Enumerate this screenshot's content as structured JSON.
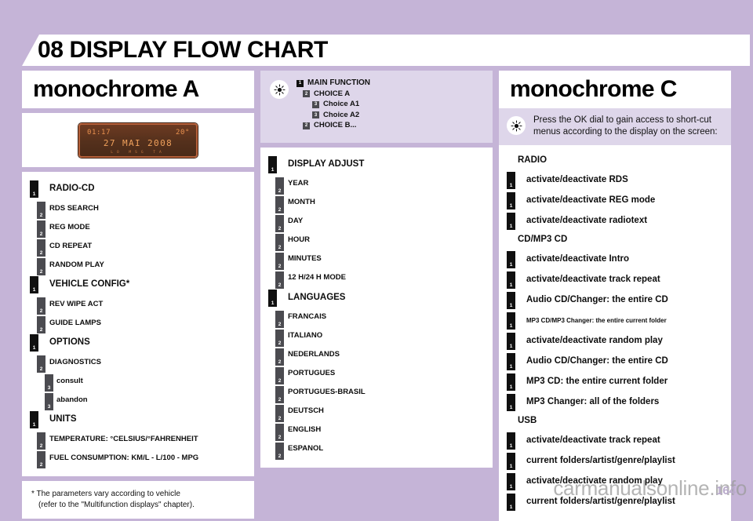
{
  "page": {
    "chapter_number": "08",
    "title": "08 DISPLAY FLOW CHART",
    "page_number": "164",
    "watermark": "carmanualsonline.info",
    "background_color": "#c5b4d7",
    "badge_level1_color": "#101010",
    "badge_level2_color": "#4b4b50"
  },
  "column_a": {
    "title": "monochrome A",
    "display": {
      "time": "01:17",
      "temperature": "20°",
      "date": "27 MAI 2008",
      "subline": "LO   MSG  TA"
    },
    "items": [
      {
        "level": "1",
        "badge": "1",
        "label": "RADIO-CD"
      },
      {
        "level": "2",
        "badge": "2",
        "label": "RDS SEARCH"
      },
      {
        "level": "2",
        "badge": "2",
        "label": "REG MODE"
      },
      {
        "level": "2",
        "badge": "2",
        "label": "CD REPEAT"
      },
      {
        "level": "2",
        "badge": "2",
        "label": "RANDOM PLAY"
      },
      {
        "level": "1",
        "badge": "1",
        "label": "VEHICLE CONFIG*"
      },
      {
        "level": "2",
        "badge": "2",
        "label": "REV WIPE ACT"
      },
      {
        "level": "2",
        "badge": "2",
        "label": "GUIDE LAMPS"
      },
      {
        "level": "1",
        "badge": "1",
        "label": "OPTIONS"
      },
      {
        "level": "2",
        "badge": "2",
        "label": "DIAGNOSTICS"
      },
      {
        "level": "3",
        "badge": "3",
        "label": "consult"
      },
      {
        "level": "3",
        "badge": "3",
        "label": "abandon"
      },
      {
        "level": "1",
        "badge": "1",
        "label": "UNITS"
      },
      {
        "level": "2",
        "badge": "2",
        "label": "TEMPERATURE: °CELSIUS/°FAHRENHEIT"
      },
      {
        "level": "2",
        "badge": "2",
        "label": "FUEL CONSUMPTION: KM/L - L/100 - MPG"
      }
    ],
    "footnote_line1": "* The parameters vary according to vehicle",
    "footnote_line2": "(refer to the \"Multifunction displays\" chapter)."
  },
  "column_b": {
    "legend_icon": "lightbulb-icon",
    "legend": [
      {
        "level": "1",
        "badge": "1",
        "label": "MAIN FUNCTION"
      },
      {
        "level": "2",
        "badge": "2",
        "label": "CHOICE A"
      },
      {
        "level": "3",
        "badge": "3",
        "label": "Choice A1"
      },
      {
        "level": "3",
        "badge": "3",
        "label": "Choice A2"
      },
      {
        "level": "2",
        "badge": "2",
        "label": "CHOICE B..."
      }
    ],
    "items": [
      {
        "level": "1",
        "badge": "1",
        "label": "DISPLAY ADJUST"
      },
      {
        "level": "2",
        "badge": "2",
        "label": "YEAR"
      },
      {
        "level": "2",
        "badge": "2",
        "label": "MONTH"
      },
      {
        "level": "2",
        "badge": "2",
        "label": "DAY"
      },
      {
        "level": "2",
        "badge": "2",
        "label": "HOUR"
      },
      {
        "level": "2",
        "badge": "2",
        "label": "MINUTES"
      },
      {
        "level": "2",
        "badge": "2",
        "label": "12 H/24 H MODE"
      },
      {
        "level": "1",
        "badge": "1",
        "label": "LANGUAGES"
      },
      {
        "level": "2",
        "badge": "2",
        "label": "FRANCAIS"
      },
      {
        "level": "2",
        "badge": "2",
        "label": "ITALIANO"
      },
      {
        "level": "2",
        "badge": "2",
        "label": "NEDERLANDS"
      },
      {
        "level": "2",
        "badge": "2",
        "label": "PORTUGUES"
      },
      {
        "level": "2",
        "badge": "2",
        "label": "PORTUGUES-BRASIL"
      },
      {
        "level": "2",
        "badge": "2",
        "label": "DEUTSCH"
      },
      {
        "level": "2",
        "badge": "2",
        "label": "ENGLISH"
      },
      {
        "level": "2",
        "badge": "2",
        "label": "ESPANOL"
      }
    ]
  },
  "column_c": {
    "title": "monochrome C",
    "blurb_icon": "lightbulb-icon",
    "blurb": "Press the OK dial to gain access to short-cut menus according to the display on the screen:",
    "sections": [
      {
        "heading": "RADIO",
        "items": [
          {
            "badge": "1",
            "label": "activate/deactivate RDS",
            "small": false
          },
          {
            "badge": "1",
            "label": "activate/deactivate REG mode",
            "small": false
          },
          {
            "badge": "1",
            "label": "activate/deactivate radiotext",
            "small": false
          }
        ]
      },
      {
        "heading": "CD/MP3 CD",
        "items": [
          {
            "badge": "1",
            "label": "activate/deactivate Intro",
            "small": false
          },
          {
            "badge": "1",
            "label": "activate/deactivate track repeat",
            "small": false
          },
          {
            "badge": "1",
            "label": "Audio CD/Changer: the entire CD",
            "small": false
          },
          {
            "badge": "1",
            "label": "MP3 CD/MP3 Changer: the entire current folder",
            "small": true
          },
          {
            "badge": "1",
            "label": "activate/deactivate random play",
            "small": false
          },
          {
            "badge": "1",
            "label": "Audio CD/Changer: the entire CD",
            "small": false
          },
          {
            "badge": "1",
            "label": "MP3 CD: the entire current folder",
            "small": false
          },
          {
            "badge": "1",
            "label": "MP3 Changer: all of the folders",
            "small": false
          }
        ]
      },
      {
        "heading": "USB",
        "items": [
          {
            "badge": "1",
            "label": "activate/deactivate track repeat",
            "small": false
          },
          {
            "badge": "1",
            "label": "current folders/artist/genre/playlist",
            "small": false
          },
          {
            "badge": "1",
            "label": "activate/deactivate random play",
            "small": false
          },
          {
            "badge": "1",
            "label": "current folders/artist/genre/playlist",
            "small": false
          }
        ]
      }
    ]
  }
}
